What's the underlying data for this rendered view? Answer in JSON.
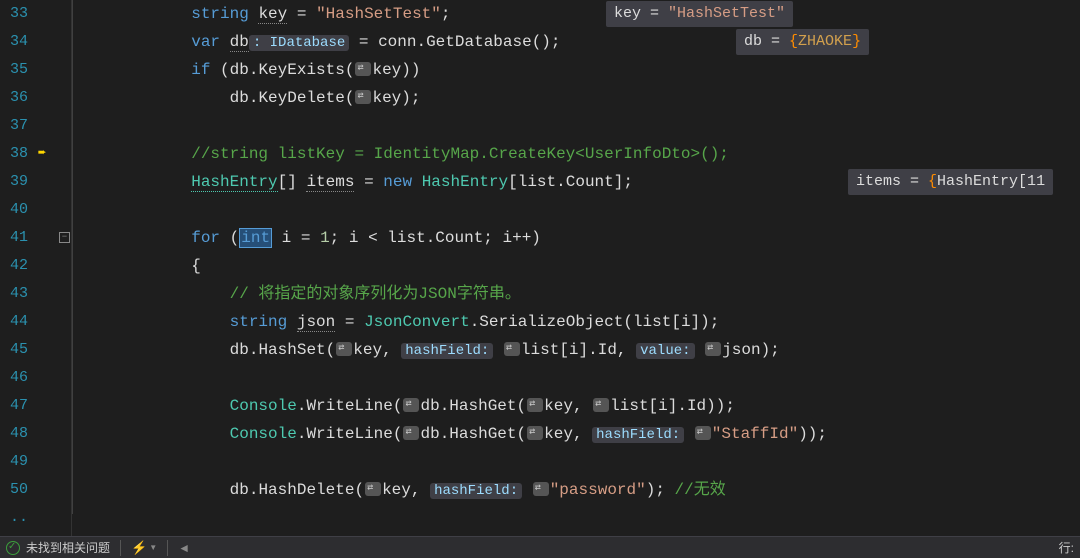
{
  "lineNumbers": [
    "33",
    "34",
    "35",
    "36",
    "37",
    "38",
    "39",
    "40",
    "41",
    "42",
    "43",
    "44",
    "45",
    "46",
    "47",
    "48",
    "49",
    "50",
    ".."
  ],
  "code": {
    "l33": {
      "prefix": "            ",
      "kw1": "string",
      "sp1": " ",
      "ident1": "key",
      "op1": " = ",
      "str1": "\"HashSetTest\"",
      "end1": ";"
    },
    "l33_hint": {
      "name": "key",
      "eq": " = ",
      "val": "\"HashSetTest\""
    },
    "l34": {
      "prefix": "            ",
      "kw1": "var",
      "sp1": " ",
      "ident1": "db",
      "hint": ": IDatabase",
      "op1": " = conn.",
      "meth": "GetDatabase",
      "paren": "();"
    },
    "l34_hint": {
      "name": "db",
      "eq": " = ",
      "br1": "{",
      "val": "ZHAOKE",
      "br2": "}"
    },
    "l35": {
      "prefix": "            ",
      "kw1": "if",
      "sp1": " (db.",
      "meth": "KeyExists",
      "p1": "(",
      "picon": true,
      "arg": "key",
      "p2": "))"
    },
    "l36": {
      "prefix": "                db.",
      "meth": "KeyDelete",
      "p1": "(",
      "picon": true,
      "arg": "key",
      "p2": ");"
    },
    "l38": {
      "prefix": "            ",
      "cmt": "//string listKey = IdentityMap.CreateKey<UserInfoDto>();"
    },
    "l39": {
      "prefix": "            ",
      "type1": "HashEntry",
      "arr": "[] ",
      "ident1": "items",
      "op1": " = ",
      "kw1": "new",
      "sp1": " ",
      "type2": "HashEntry",
      "br": "[list.Count];"
    },
    "l39_hint": {
      "name": "items",
      "eq": " = ",
      "br1": "{",
      "val": "HashEntry[11"
    },
    "l41": {
      "prefix": "            ",
      "kw1": "for",
      "sp1": " (",
      "selkw": "int",
      "rest1": " i = ",
      "num1": "1",
      "rest2": "; i < list.Count; i++)"
    },
    "l42": {
      "prefix": "            {"
    },
    "l43": {
      "prefix": "                ",
      "cmt": "// 将指定的对象序列化为JSON字符串。"
    },
    "l44": {
      "prefix": "                ",
      "kw1": "string",
      "sp1": " ",
      "ident1": "json",
      "op1": " = ",
      "type1": "JsonConvert",
      "dot": ".",
      "meth": "SerializeObject",
      "rest": "(list[i]);"
    },
    "l45": {
      "prefix": "                db.",
      "meth": "HashSet",
      "p1": "(",
      "arg1": "key",
      "c1": ", ",
      "hint1": "hashField:",
      "sp1": " ",
      "arg2": "list[i].Id",
      "c2": ", ",
      "hint2": "value:",
      "sp2": " ",
      "arg3": "json",
      "p2": ");"
    },
    "l47": {
      "prefix": "                ",
      "type1": "Console",
      "dot": ".",
      "meth": "WriteLine",
      "p1": "(",
      "arg1": "db.",
      "meth2": "HashGet",
      "p2": "(",
      "arg2": "key",
      "c1": ", ",
      "arg3": "list[i].Id",
      "p3": "));"
    },
    "l48": {
      "prefix": "                ",
      "type1": "Console",
      "dot": ".",
      "meth": "WriteLine",
      "p1": "(",
      "arg1": "db.",
      "meth2": "HashGet",
      "p2": "(",
      "arg2": "key",
      "c1": ", ",
      "hint1": "hashField:",
      "sp1": " ",
      "str1": "\"StaffId\"",
      "p3": "));"
    },
    "l50": {
      "prefix": "                db.",
      "meth": "HashDelete",
      "p1": "(",
      "arg1": "key",
      "c1": ", ",
      "hint1": "hashField:",
      "sp1": " ",
      "str1": "\"password\"",
      "p2": "); ",
      "cmt": "//无效"
    }
  },
  "status": {
    "noIssues": "未找到相关问题",
    "lineLabel": "行:"
  }
}
